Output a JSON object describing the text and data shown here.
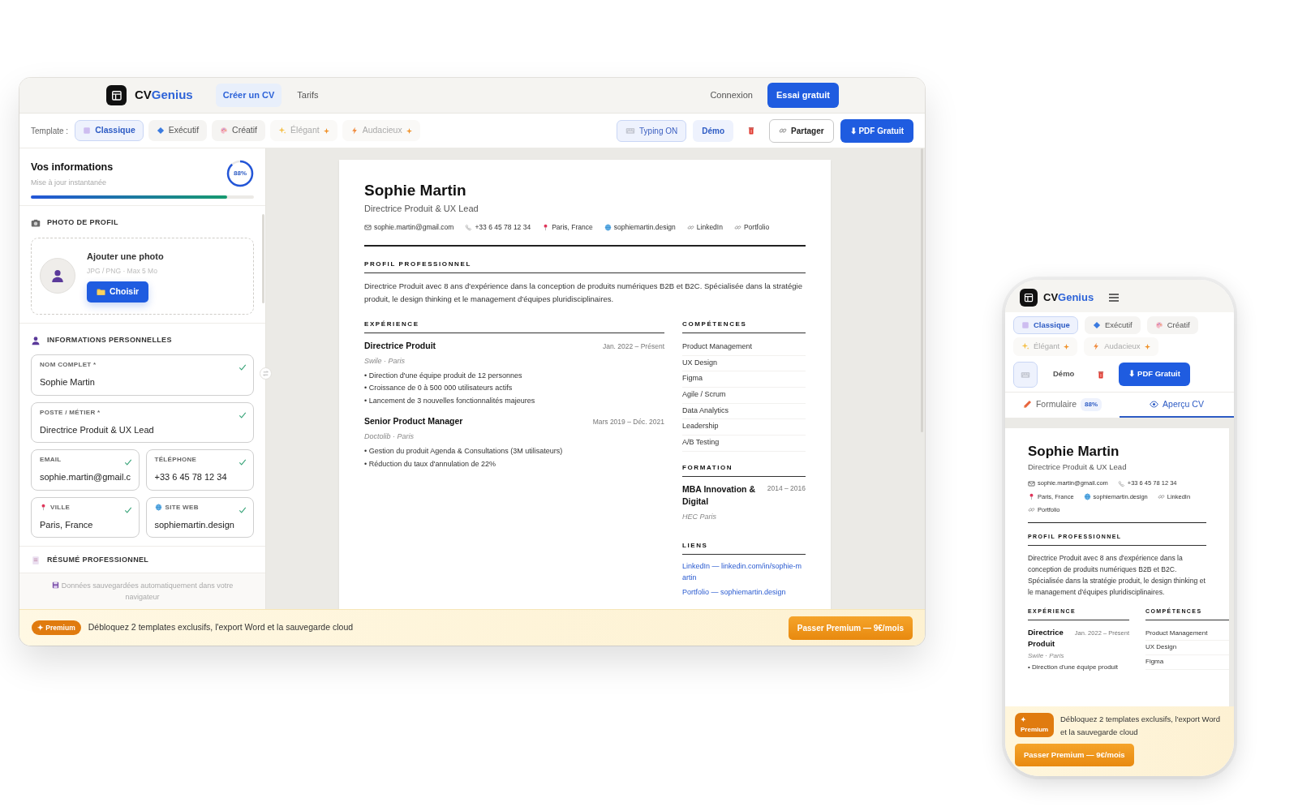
{
  "desktop": {
    "nav": {
      "brand": {
        "prefix": "CV",
        "suffix": "Genius"
      },
      "links": [
        {
          "label": "Créer un CV",
          "selected": true
        },
        {
          "label": "Tarifs",
          "selected": false
        }
      ],
      "login": "Connexion",
      "cta": "Essai gratuit"
    },
    "toolbar": {
      "label": "Template :",
      "templates": [
        {
          "label": "Classique",
          "selected": true,
          "premium": false
        },
        {
          "label": "Exécutif",
          "selected": false,
          "premium": false
        },
        {
          "label": "Créatif",
          "selected": false,
          "premium": false
        },
        {
          "label": "Élégant",
          "selected": false,
          "premium": true
        },
        {
          "label": "Audacieux",
          "selected": false,
          "premium": true
        }
      ],
      "typing": "Typing ON",
      "demo": "Démo",
      "share": "Partager",
      "pdf": "⬇ PDF Gratuit"
    },
    "sidebar": {
      "title": "Vos informations",
      "subtitle": "Mise à jour instantanée",
      "progress_label": "88%",
      "level": 0.88,
      "sections": [
        {
          "kind": "photo",
          "heading": "PHOTO DE PROFIL",
          "prompt": "Ajouter une photo",
          "hint": "JPG / PNG · Max 5 Mo",
          "button": "Choisir"
        },
        {
          "kind": "fields",
          "heading": "INFORMATIONS PERSONNELLES",
          "fields": [
            {
              "kind": "text",
              "wide": true,
              "label": "NOM COMPLET *",
              "value": "Sophie Martin",
              "checked": true
            },
            {
              "kind": "text",
              "wide": true,
              "label": "POSTE / MÉTIER *",
              "value": "Directrice Produit & UX Lead",
              "checked": true
            },
            {
              "kind": "text",
              "wide": false,
              "label": "EMAIL",
              "value": "sophie.martin@gmail.c",
              "checked": true
            },
            {
              "kind": "text",
              "wide": false,
              "label": "TÉLÉPHONE",
              "value": "+33 6 45 78 12 34",
              "checked": true
            },
            {
              "kind": "location",
              "wide": false,
              "label": "VILLE",
              "value": "Paris, France",
              "checked": true
            },
            {
              "kind": "web",
              "wide": false,
              "label": "SITE WEB",
              "value": "sophiemartin.design",
              "checked": true
            }
          ]
        },
        {
          "kind": "collapsed",
          "heading": "RÉSUMÉ PROFESSIONNEL"
        }
      ],
      "footer": "Données sauvegardées automatiquement dans votre navigateur"
    },
    "cv": {
      "name": "Sophie Martin",
      "title": "Directrice Produit & UX Lead",
      "contacts": [
        {
          "kind": "email",
          "text": "sophie.martin@gmail.com"
        },
        {
          "kind": "phone",
          "text": "+33 6 45 78 12 34"
        },
        {
          "kind": "location",
          "text": "Paris, France"
        },
        {
          "kind": "web",
          "text": "sophiemartin.design"
        },
        {
          "kind": "link",
          "text": "LinkedIn"
        },
        {
          "kind": "link",
          "text": "Portfolio"
        }
      ],
      "profile_heading": "PROFIL PROFESSIONNEL",
      "profile": "Directrice Produit avec 8 ans d'expérience dans la conception de produits numériques B2B et B2C. Spécialisée dans la stratégie produit, le design thinking et le management d'équipes pluridisciplinaires.",
      "experience_heading": "EXPÉRIENCE",
      "jobs": [
        {
          "title": "Directrice Produit",
          "date": "Jan. 2022 – Présent",
          "company": "Swile · Paris",
          "bullets": [
            "• Direction d'une équipe produit de 12 personnes",
            "• Croissance de 0 à 500 000 utilisateurs actifs",
            "• Lancement de 3 nouvelles fonctionnalités majeures"
          ]
        },
        {
          "title": "Senior Product Manager",
          "date": "Mars 2019 – Déc. 2021",
          "company": "Doctolib · Paris",
          "bullets": [
            "• Gestion du produit Agenda & Consultations (3M utilisateurs)",
            "• Réduction du taux d'annulation de 22%"
          ]
        }
      ],
      "skills_heading": "COMPÉTENCES",
      "skills": [
        "Product Management",
        "UX Design",
        "Figma",
        "Agile / Scrum",
        "Data Analytics",
        "Leadership",
        "A/B Testing"
      ],
      "education_heading": "FORMATION",
      "education": {
        "degree": "MBA Innovation & Digital",
        "date": "2014 – 2016",
        "school": "HEC Paris"
      },
      "links_heading": "LIENS",
      "links": [
        "LinkedIn — linkedin.com/in/sophie-martin",
        "Portfolio — sophiemartin.design"
      ]
    },
    "premium": {
      "badge": "✦ Premium",
      "text": "Débloquez 2 templates exclusifs, l'export Word et la sauvegarde cloud",
      "button": "Passer Premium — 9€/mois"
    }
  },
  "mobile": {
    "brand": {
      "prefix": "CV",
      "suffix": "Genius"
    },
    "templates": [
      {
        "label": "Classique",
        "selected": true,
        "premium": false
      },
      {
        "label": "Exécutif",
        "selected": false,
        "premium": false
      },
      {
        "label": "Créatif",
        "selected": false,
        "premium": false
      },
      {
        "label": "Élégant",
        "selected": false,
        "premium": true
      },
      {
        "label": "Audacieux",
        "selected": false,
        "premium": true
      }
    ],
    "demo": "Démo",
    "pdf": "⬇ PDF Gratuit",
    "tabs": [
      {
        "label": "Formulaire",
        "badge": "88%",
        "selected": false
      },
      {
        "label": "Aperçu CV",
        "selected": true
      }
    ],
    "cv": {
      "name": "Sophie Martin",
      "title": "Directrice Produit & UX Lead",
      "contacts": [
        {
          "kind": "email",
          "text": "sophie.martin@gmail.com"
        },
        {
          "kind": "phone",
          "text": "+33 6 45 78 12 34"
        },
        {
          "kind": "location",
          "text": "Paris, France"
        },
        {
          "kind": "web",
          "text": "sophiemartin.design"
        },
        {
          "kind": "link",
          "text": "LinkedIn"
        },
        {
          "kind": "link",
          "text": "Portfolio"
        }
      ],
      "profile_heading": "PROFIL PROFESSIONNEL",
      "profile": "Directrice Produit avec 8 ans d'expérience dans la conception de produits numériques B2B et B2C. Spécialisée dans la stratégie produit, le design thinking et le management d'équipes pluridisciplinaires.",
      "experience_heading": "EXPÉRIENCE",
      "jobs": [
        {
          "title": "Directrice Produit",
          "date": "Jan. 2022 – Présent",
          "company": "Swile · Paris",
          "bullets": [
            "• Direction d'une équipe produit"
          ]
        }
      ],
      "skills_heading": "COMPÉTENCES",
      "skills": [
        "Product Management",
        "UX Design",
        "Figma"
      ]
    },
    "premium": {
      "badge": "✦ Premium",
      "text": "Débloquez 2 templates exclusifs, l'export Word et la sauvegarde cloud",
      "button": "Passer Premium — 9€/mois"
    }
  }
}
